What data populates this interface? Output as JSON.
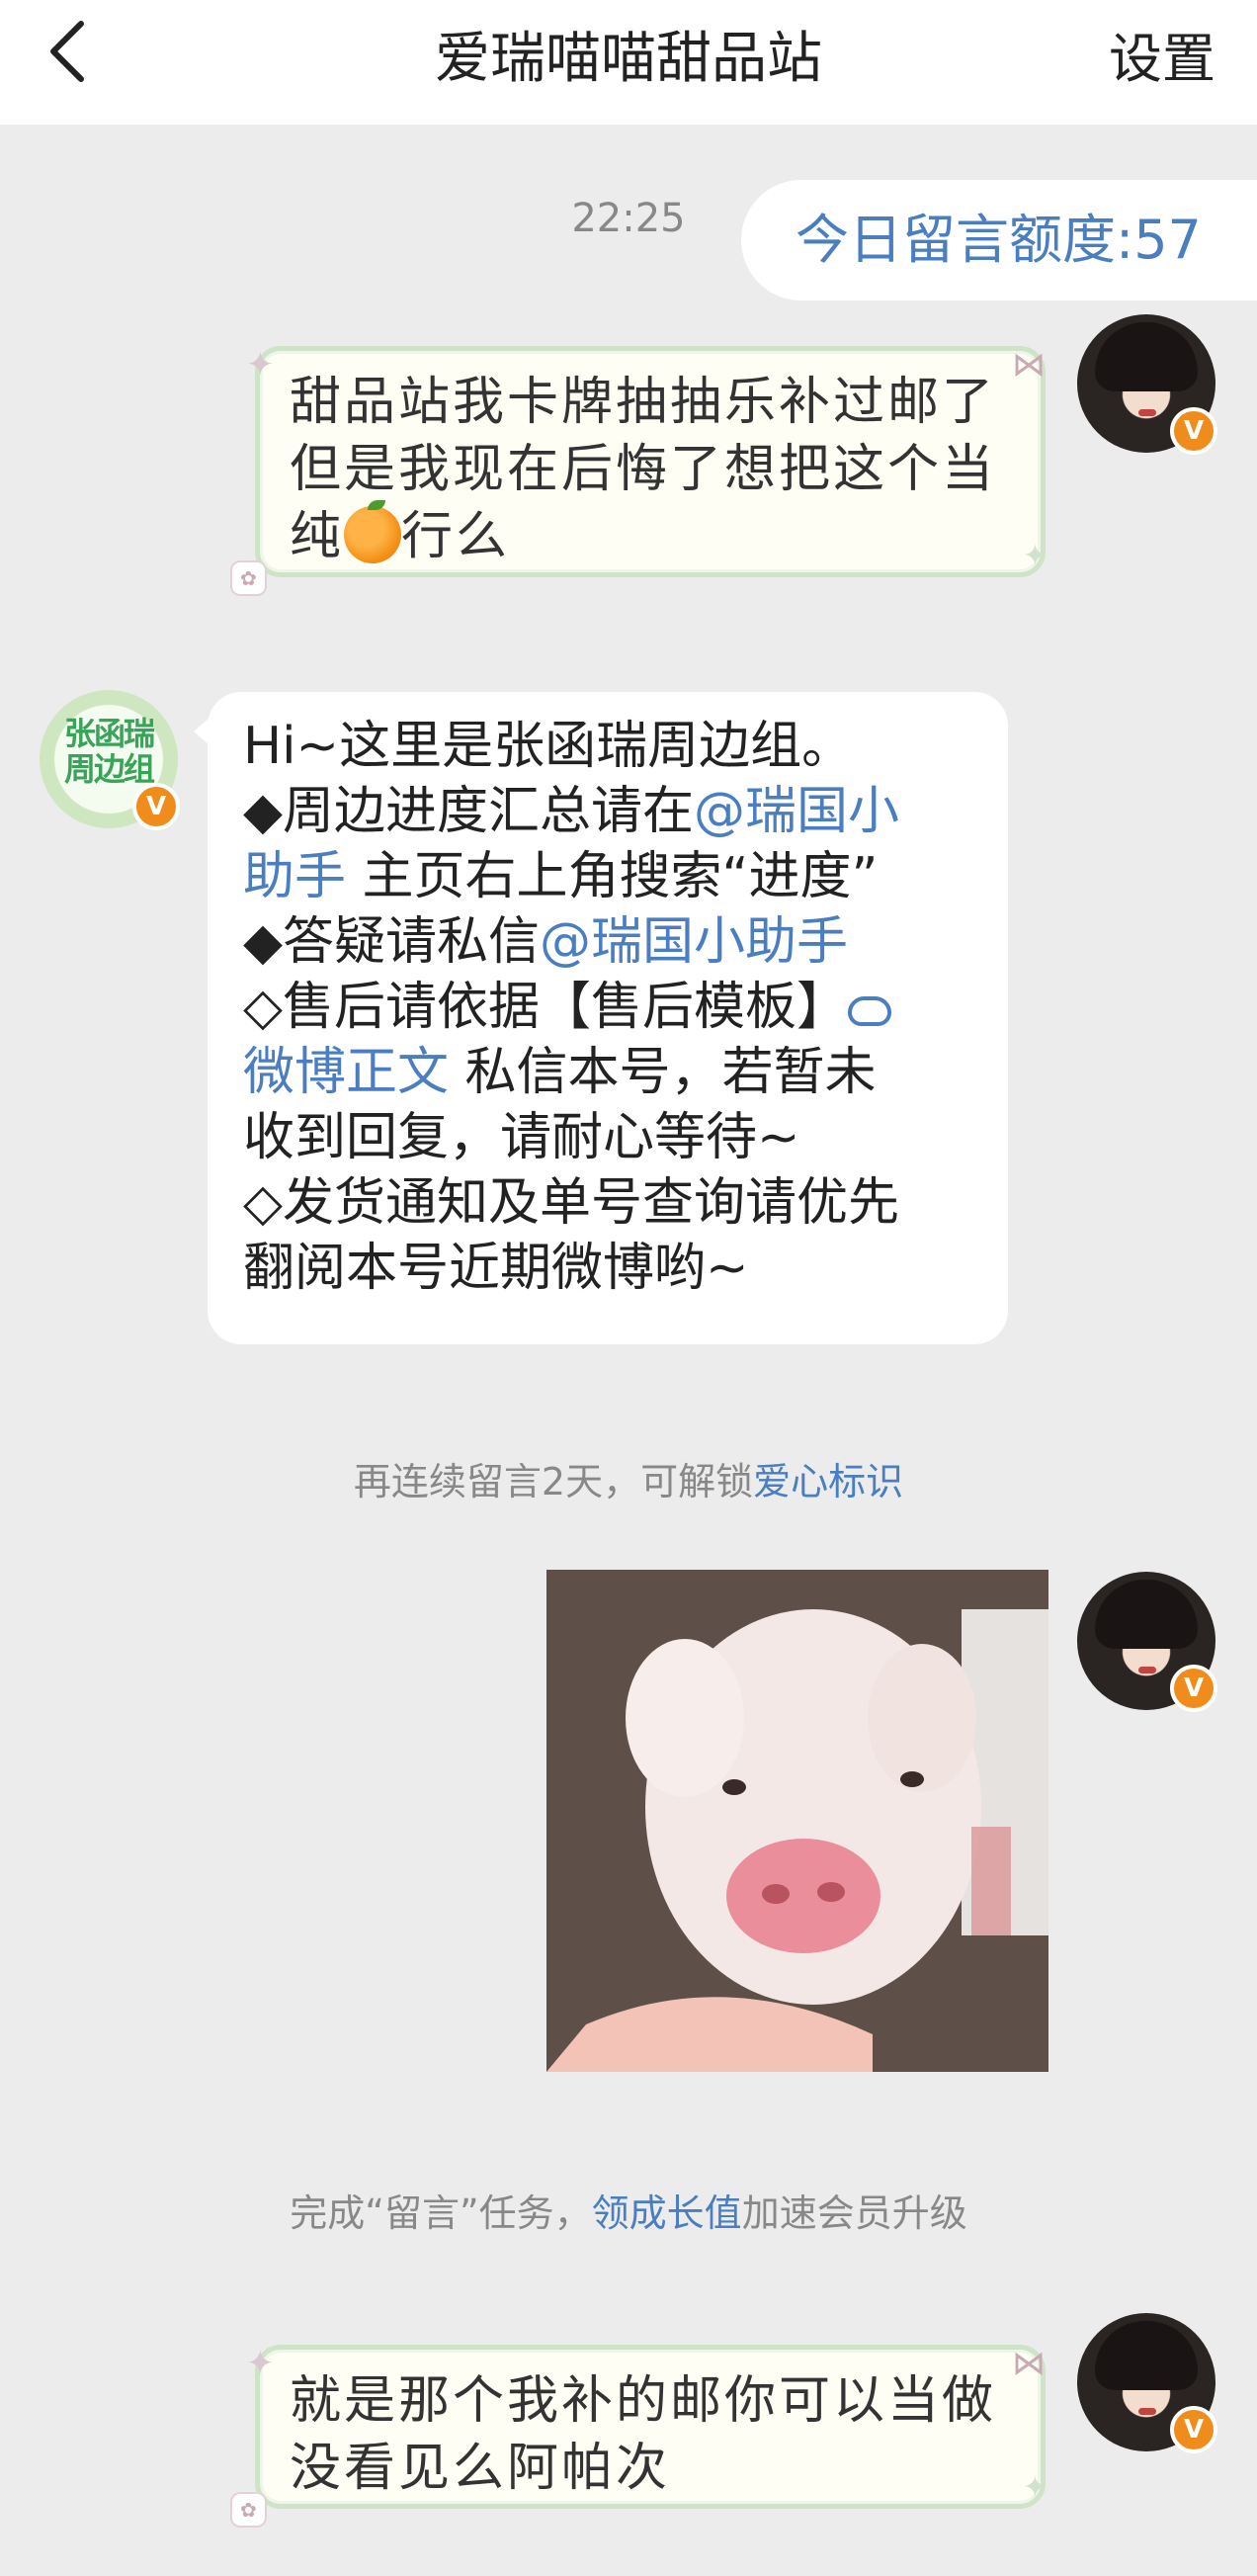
{
  "header": {
    "title": "爱瑞喵喵甜品站",
    "settings_label": "设置"
  },
  "chat": {
    "time": "22:25",
    "quota_label": "今日留言额度:57",
    "msg1": {
      "line1": "甜品站我卡牌抽抽乐补过邮了",
      "line2": "但是我现在后悔了想把这个当",
      "line3_before": "纯",
      "emoji": "orange",
      "line3_after": "行么"
    },
    "reply": {
      "avatar_text": "张函瑞周边组",
      "l1": "Hi~这里是张函瑞周边组。",
      "l2_pre": "◆周边进度汇总请在",
      "l2_link": "@瑞国小",
      "l3_link": "助手",
      "l3_post": " 主页右上角搜索“进度”",
      "l4_pre": "◆答疑请私信",
      "l4_link": "@瑞国小助手",
      "l5_pre": "◇售后请依据【售后模板】",
      "l6_link": "微博正文",
      "l6_post": " 私信本号，若暂未",
      "l7": "收到回复，请耐心等待~",
      "l8": "◇发货通知及单号查询请优先",
      "l9": "翻阅本号近期微博哟~"
    },
    "notice1_pre": "再连续留言2天，可解锁",
    "notice1_link": "爱心标识",
    "notice2_pre": "完成“留言”任务，",
    "notice2_link": "领成长值",
    "notice2_post": "加速会员升级",
    "msg3": {
      "line1": "就是那个我补的邮你可以当做",
      "line2": "没看见么阿帕次"
    },
    "badge_label": "V"
  },
  "colors": {
    "link": "#4a7ec1",
    "badge": "#f08c1c",
    "bubble_border": "#cfe3c8"
  }
}
